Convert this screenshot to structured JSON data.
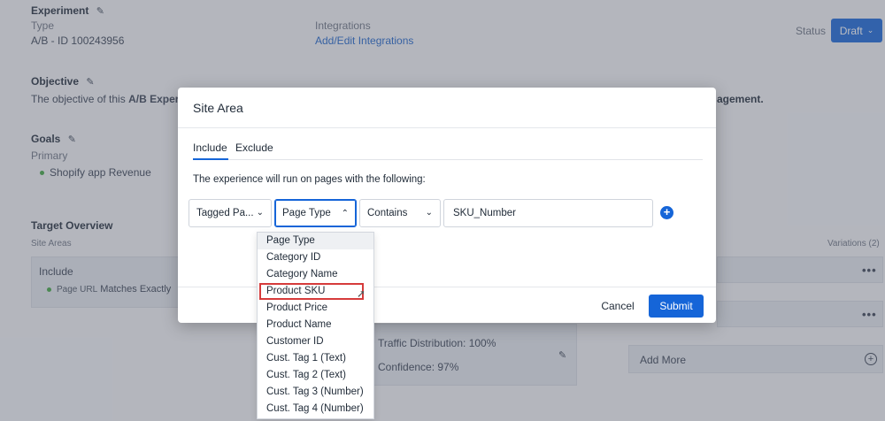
{
  "background": {
    "experiment": {
      "title": "Experiment",
      "type_label": "Type",
      "type_value": "A/B - ID 100243956",
      "integrations_label": "Integrations",
      "integrations_link": "Add/Edit Integrations"
    },
    "status": {
      "label": "Status",
      "value": "Draft"
    },
    "objective": {
      "title": "Objective",
      "text_prefix": "The objective of this ",
      "text_bold": "A/B Experi",
      "text_tail": "agement."
    },
    "goals": {
      "title": "Goals",
      "primary_label": "Primary",
      "primary_item": "Shopify app Revenue"
    },
    "target": {
      "title": "Target Overview",
      "site_areas": "Site Areas",
      "variations": "Variations (2)",
      "include": "Include",
      "rule_label": "Page URL",
      "rule_text": "Matches Exactly"
    },
    "stats": {
      "traffic": "Traffic Distribution: 100%",
      "confidence": "Confidence: 97%"
    },
    "add_more": "Add More",
    "more_icon": "•••"
  },
  "modal": {
    "title": "Site Area",
    "tabs": [
      "Include",
      "Exclude"
    ],
    "active_tab": "Include",
    "description": "The experience will run on pages with the following:",
    "filters": {
      "field1": "Tagged Pa...",
      "field2": "Page Type",
      "operator": "Contains",
      "value": "SKU_Number"
    },
    "cancel": "Cancel",
    "submit": "Submit"
  },
  "dropdown": {
    "options": [
      "Page Type",
      "Category ID",
      "Category Name",
      "Product SKU",
      "Product Price",
      "Product Name",
      "Customer ID",
      "Cust. Tag 1 (Text)",
      "Cust. Tag 2 (Text)",
      "Cust. Tag 3 (Number)",
      "Cust. Tag 4 (Number)"
    ],
    "highlighted": "Product SKU"
  },
  "colors": {
    "accent": "#1565d8",
    "highlight": "#d63b3b",
    "success_dot": "#3fa53f"
  }
}
